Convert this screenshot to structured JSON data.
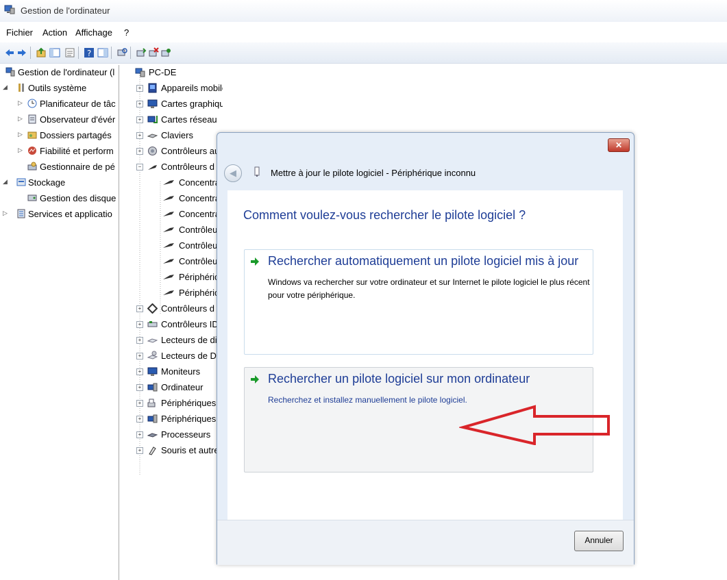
{
  "window": {
    "title": "Gestion de l'ordinateur"
  },
  "menu": [
    "Fichier",
    "Action",
    "Affichage",
    "?"
  ],
  "left_tree": [
    {
      "label": "Gestion de l'ordinateur (l",
      "icon": "computer-management-icon"
    },
    {
      "label": "Outils système",
      "icon": "tools-icon"
    },
    {
      "label": "Planificateur de tâc",
      "icon": "clock-icon"
    },
    {
      "label": "Observateur d'évér",
      "icon": "event-viewer-icon"
    },
    {
      "label": "Dossiers partagés",
      "icon": "shared-folder-icon"
    },
    {
      "label": "Fiabilité et perform",
      "icon": "performance-icon"
    },
    {
      "label": "Gestionnaire de pé",
      "icon": "device-manager-icon"
    },
    {
      "label": "Stockage",
      "icon": "storage-icon"
    },
    {
      "label": "Gestion des disque",
      "icon": "disk-icon"
    },
    {
      "label": "Services et applicatio",
      "icon": "services-icon"
    }
  ],
  "device_tree": {
    "root": "PC-DE",
    "categories": [
      "Appareils mobiles",
      "Cartes graphiques",
      "Cartes réseau",
      "Claviers",
      "Contrôleurs au",
      "Contrôleurs d"
    ],
    "children": [
      "Concentra",
      "Concentra",
      "Concentra",
      "Contrôleu",
      "Contrôleu",
      "Contrôleu",
      "Périphéric",
      "Périphéric"
    ],
    "categories_after": [
      "Contrôleurs d",
      "Contrôleurs ID",
      "Lecteurs de di",
      "Lecteurs de D",
      "Moniteurs",
      "Ordinateur",
      "Périphériques",
      "Périphériques",
      "Processeurs",
      "Souris et autre"
    ]
  },
  "dialog": {
    "close_glyph": "✕",
    "back_glyph": "◀",
    "title": "Mettre à jour le pilote logiciel - Périphérique inconnu",
    "question": "Comment voulez-vous rechercher le pilote logiciel ?",
    "options": [
      {
        "title": "Rechercher automatiquement un pilote logiciel mis à jour",
        "description": "Windows va rechercher sur votre ordinateur et sur Internet le pilote logiciel le plus récent pour votre périphérique."
      },
      {
        "title": "Rechercher un pilote logiciel sur mon ordinateur",
        "description": "Recherchez et installez manuellement le pilote logiciel."
      }
    ],
    "cancel_label": "Annuler"
  },
  "colors": {
    "link_blue": "#1e3d96",
    "arrow_green": "#1a9a2a",
    "annotation_red": "#d9252a"
  }
}
